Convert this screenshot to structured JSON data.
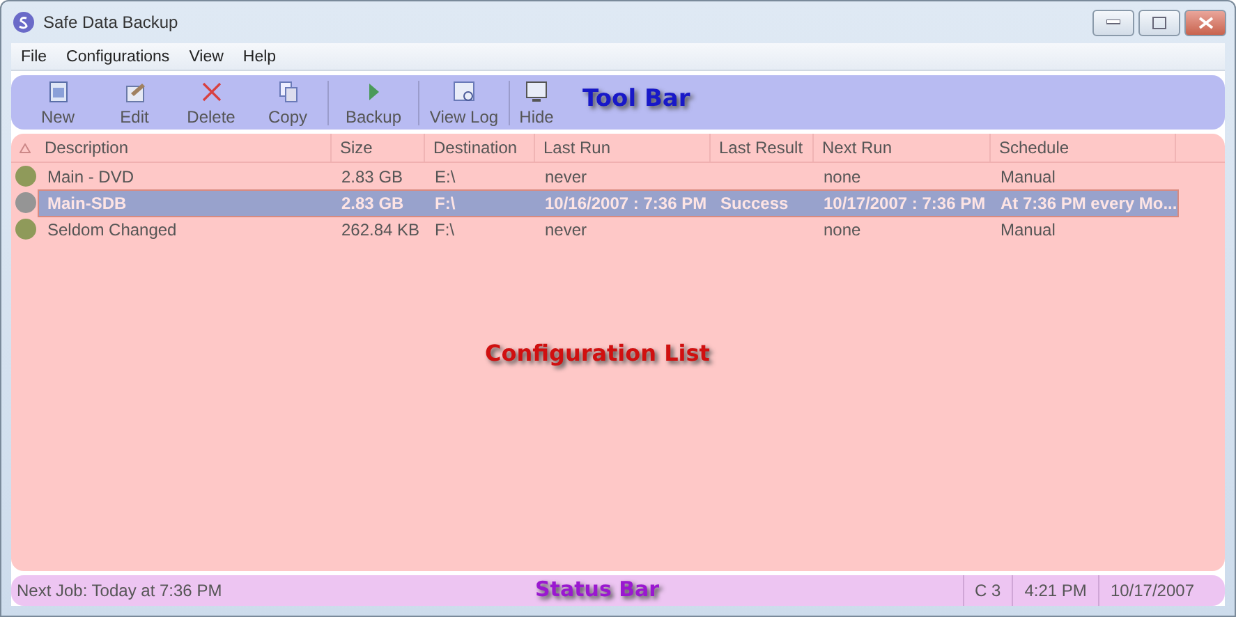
{
  "window": {
    "title": "Safe Data Backup"
  },
  "menu": [
    "File",
    "Configurations",
    "View",
    "Help"
  ],
  "toolbar": [
    {
      "label": "New",
      "kind": "new"
    },
    {
      "label": "Edit",
      "kind": "edit"
    },
    {
      "label": "Delete",
      "kind": "delete"
    },
    {
      "label": "Copy",
      "kind": "copy"
    },
    {
      "kind": "separator"
    },
    {
      "label": "Backup",
      "kind": "backup"
    },
    {
      "kind": "separator"
    },
    {
      "label": "View Log",
      "kind": "log"
    },
    {
      "kind": "separator"
    },
    {
      "label": "Hide",
      "kind": "hide"
    }
  ],
  "table": {
    "columns": [
      "Description",
      "Size",
      "Destination",
      "Last Run",
      "Last Result",
      "Next Run",
      "Schedule"
    ],
    "rows": [
      {
        "cells": [
          "Main - DVD",
          "2.83 GB",
          "E:\\",
          "never",
          "",
          "none",
          "Manual"
        ],
        "selected": false,
        "color": "#8f9a5a"
      },
      {
        "cells": [
          "Main-SDB",
          "2.83 GB",
          "F:\\",
          "10/16/2007 : 7:36 PM",
          "Success",
          "10/17/2007 : 7:36 PM",
          "At 7:36 PM every Mo..."
        ],
        "selected": true,
        "color": "#959595"
      },
      {
        "cells": [
          "Seldom Changed",
          "262.84 KB",
          "F:\\",
          "never",
          "",
          "none",
          "Manual"
        ],
        "selected": false,
        "color": "#8f9a5a"
      }
    ]
  },
  "status_bar": {
    "message": "Next Job: Today at 7:36 PM",
    "panels": [
      "C 3",
      "4:21 PM",
      "10/17/2007"
    ]
  },
  "annotations": [
    {
      "text": "Tool Bar",
      "kind": "toolbar"
    },
    {
      "text": "Configuration List",
      "kind": "list"
    },
    {
      "text": "Status Bar",
      "kind": "status"
    }
  ]
}
